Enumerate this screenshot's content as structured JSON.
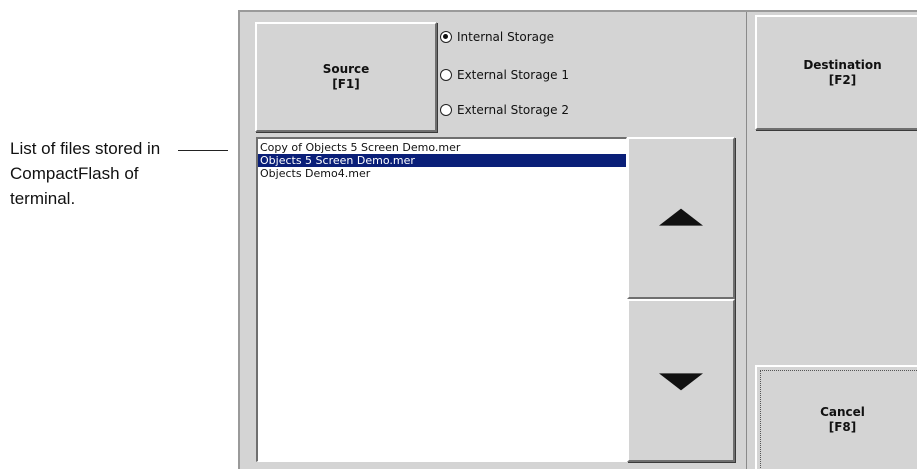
{
  "callout": {
    "text": "List of files stored in CompactFlash of terminal."
  },
  "source_button": {
    "line1": "Source",
    "line2": "[F1]"
  },
  "storage_options": [
    {
      "label": "Internal Storage",
      "checked": true
    },
    {
      "label": "External Storage 1",
      "checked": false
    },
    {
      "label": "External Storage 2",
      "checked": false
    }
  ],
  "files": [
    {
      "name": "Copy of Objects 5 Screen Demo.mer",
      "selected": false
    },
    {
      "name": "Objects 5 Screen Demo.mer",
      "selected": true
    },
    {
      "name": "Objects Demo4.mer",
      "selected": false
    }
  ],
  "scroll": {
    "up_icon": "triangle-up-icon",
    "down_icon": "triangle-down-icon"
  },
  "destination_button": {
    "line1": "Destination",
    "line2": "[F2]"
  },
  "cancel_button": {
    "line1": "Cancel",
    "line2": "[F8]"
  },
  "colors": {
    "panel": "#d4d4d4",
    "selection": "#0a1f78"
  }
}
